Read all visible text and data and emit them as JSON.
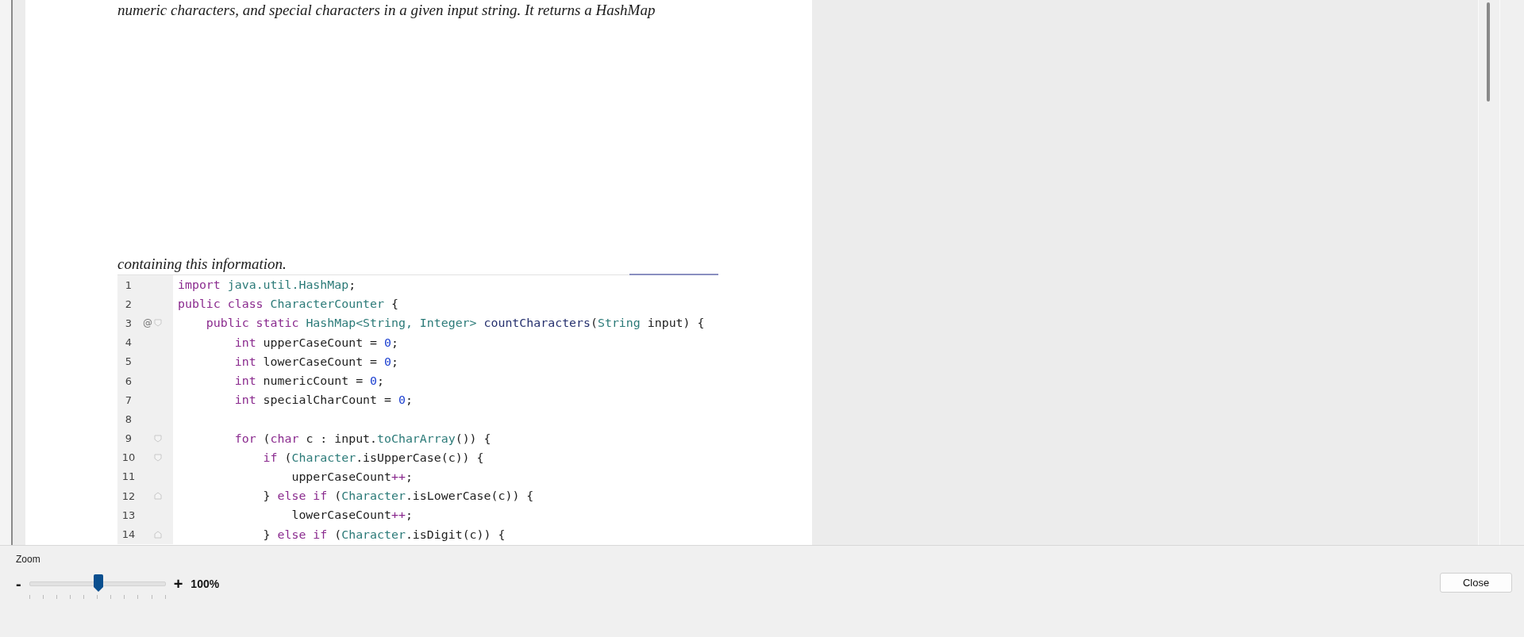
{
  "document": {
    "paragraphs": [
      "numeric characters, and special characters in a given input string. It returns a HashMap",
      "containing this information."
    ],
    "code": [
      {
        "number": "1",
        "kind": "plain",
        "tokens": [
          {
            "kind": "keyword",
            "t": "import "
          },
          {
            "kind": "type",
            "t": "java.util.HashMap"
          },
          {
            "kind": "plain",
            "t": ";"
          }
        ]
      },
      {
        "number": "2",
        "kind": "plain",
        "tokens": [
          {
            "kind": "keyword",
            "t": "public class "
          },
          {
            "kind": "type",
            "t": "CharacterCounter"
          },
          {
            "kind": "plain",
            "t": " {"
          }
        ]
      },
      {
        "number": "3",
        "annotation": "@",
        "kind": "fold-start",
        "tokens": [
          {
            "kind": "keyword",
            "t": "    public static "
          },
          {
            "kind": "type",
            "t": "HashMap<String, Integer>"
          },
          {
            "kind": "method",
            "t": " countCharacters"
          },
          {
            "kind": "plain",
            "t": "("
          },
          {
            "kind": "type",
            "t": "String"
          },
          {
            "kind": "plain",
            "t": " input) {"
          }
        ]
      },
      {
        "number": "4",
        "kind": "plain",
        "tokens": [
          {
            "kind": "keyword",
            "t": "        int "
          },
          {
            "kind": "plain",
            "t": "upperCaseCount = "
          },
          {
            "kind": "number",
            "t": "0"
          },
          {
            "kind": "plain",
            "t": ";"
          }
        ]
      },
      {
        "number": "5",
        "kind": "plain",
        "tokens": [
          {
            "kind": "keyword",
            "t": "        int "
          },
          {
            "kind": "plain",
            "t": "lowerCaseCount = "
          },
          {
            "kind": "number",
            "t": "0"
          },
          {
            "kind": "plain",
            "t": ";"
          }
        ]
      },
      {
        "number": "6",
        "kind": "plain",
        "tokens": [
          {
            "kind": "keyword",
            "t": "        int "
          },
          {
            "kind": "plain",
            "t": "numericCount = "
          },
          {
            "kind": "number",
            "t": "0"
          },
          {
            "kind": "plain",
            "t": ";"
          }
        ]
      },
      {
        "number": "7",
        "kind": "plain",
        "tokens": [
          {
            "kind": "keyword",
            "t": "        int "
          },
          {
            "kind": "plain",
            "t": "specialCharCount = "
          },
          {
            "kind": "number",
            "t": "0"
          },
          {
            "kind": "plain",
            "t": ";"
          }
        ]
      },
      {
        "number": "8",
        "kind": "plain"
      },
      {
        "number": "9",
        "kind": "fold-start",
        "tokens": [
          {
            "kind": "keyword",
            "t": "        for "
          },
          {
            "kind": "plain",
            "t": "("
          },
          {
            "kind": "keyword",
            "t": "char "
          },
          {
            "kind": "plain",
            "t": "c : input."
          },
          {
            "kind": "type",
            "t": "toCharArray"
          },
          {
            "kind": "plain",
            "t": "()) {"
          }
        ]
      },
      {
        "number": "10",
        "kind": "fold-start",
        "tokens": [
          {
            "kind": "keyword",
            "t": "            if "
          },
          {
            "kind": "plain",
            "t": "("
          },
          {
            "kind": "type",
            "t": "Character"
          },
          {
            "kind": "plain",
            "t": ".isUpperCase(c)) {"
          }
        ]
      },
      {
        "number": "11",
        "kind": "plain",
        "tokens": [
          {
            "kind": "plain",
            "t": "                upperCaseCount"
          },
          {
            "kind": "keyword",
            "t": "++"
          },
          {
            "kind": "plain",
            "t": ";"
          }
        ]
      },
      {
        "number": "12",
        "kind": "fold-end",
        "tokens": [
          {
            "kind": "plain",
            "t": "            } "
          },
          {
            "kind": "keyword",
            "t": "else if "
          },
          {
            "kind": "plain",
            "t": "("
          },
          {
            "kind": "type",
            "t": "Character"
          },
          {
            "kind": "plain",
            "t": ".isLowerCase(c)) {"
          }
        ]
      },
      {
        "number": "13",
        "kind": "plain",
        "tokens": [
          {
            "kind": "plain",
            "t": "                lowerCaseCount"
          },
          {
            "kind": "keyword",
            "t": "++"
          },
          {
            "kind": "plain",
            "t": ";"
          }
        ]
      },
      {
        "number": "14",
        "kind": "fold-end",
        "tokens": [
          {
            "kind": "plain",
            "t": "            } "
          },
          {
            "kind": "keyword",
            "t": "else if "
          },
          {
            "kind": "plain",
            "t": "("
          },
          {
            "kind": "type",
            "t": "Character"
          },
          {
            "kind": "plain",
            "t": ".isDigit(c)) {"
          }
        ]
      }
    ]
  },
  "zoom": {
    "label": "Zoom",
    "minus": "-",
    "plus": "+",
    "level": 0.51,
    "reading": "100%"
  },
  "buttons": [
    "Close"
  ]
}
